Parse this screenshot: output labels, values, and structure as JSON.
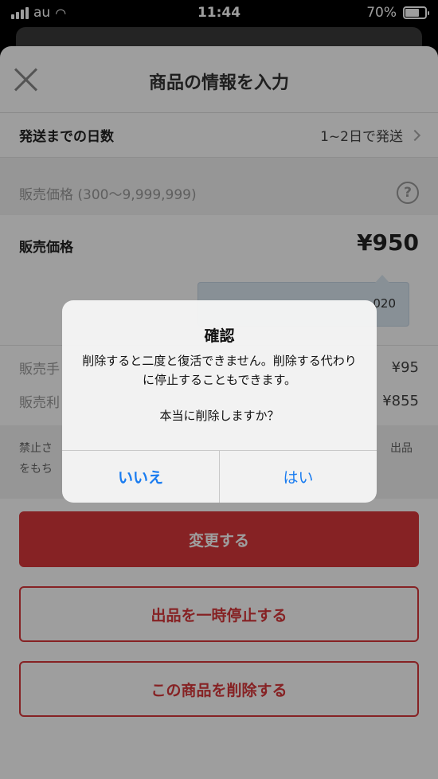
{
  "status": {
    "carrier": "au",
    "time": "11:44",
    "battery": "70%",
    "battery_level": 0.7
  },
  "nav": {
    "title": "商品の情報を入力"
  },
  "shipping": {
    "label": "発送までの日数",
    "value": "1~2日で発送"
  },
  "price_section": {
    "header": "販売価格 (300〜9,999,999)",
    "help": "?",
    "label": "販売価格",
    "value": "¥950",
    "tooltip_partial": "020"
  },
  "fees": {
    "fee_label": "販売手",
    "fee_value": "¥95",
    "profit_label": "販売利",
    "profit_value": "¥855"
  },
  "notes": {
    "line1_left": "禁止さ",
    "line2_left": "をもち",
    "line1_right": "出品"
  },
  "buttons": {
    "update": "変更する",
    "pause": "出品を一時停止する",
    "delete": "この商品を削除する"
  },
  "alert": {
    "title": "確認",
    "message": "削除すると二度と復活できません。削除する代わりに停止することもできます。",
    "confirm": "本当に削除しますか？",
    "no_label": "いいえ",
    "yes_label": "はい"
  }
}
